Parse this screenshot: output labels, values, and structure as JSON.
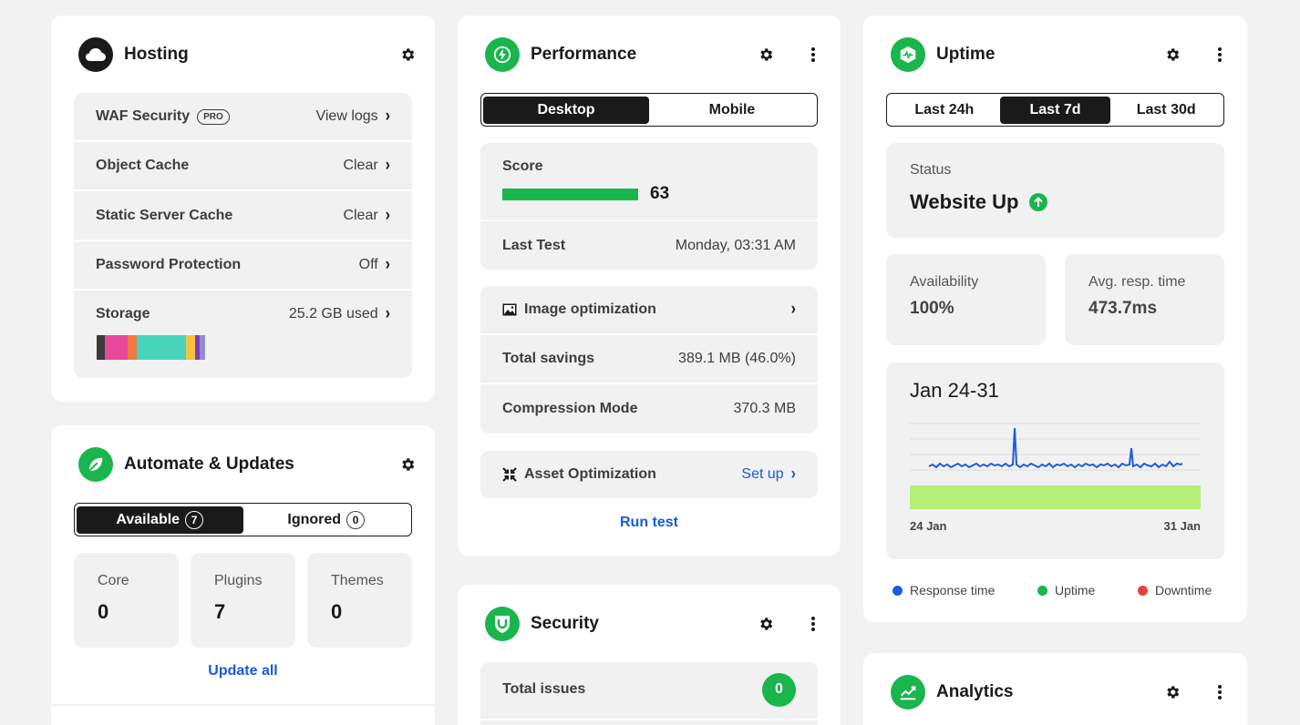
{
  "hosting": {
    "title": "Hosting",
    "rows": [
      {
        "label": "WAF Security",
        "badge": "PRO",
        "value": "View logs"
      },
      {
        "label": "Object Cache",
        "value": "Clear"
      },
      {
        "label": "Static Server Cache",
        "value": "Clear"
      },
      {
        "label": "Password Protection",
        "value": "Off"
      },
      {
        "label": "Storage",
        "value": "25.2 GB used"
      }
    ],
    "storage_colors": [
      "#3b3b3b",
      "#e8489a",
      "#f07a3f",
      "#47d3bc",
      "#f5c242",
      "#7c3fb7",
      "#b0b0b0"
    ]
  },
  "automate": {
    "title": "Automate & Updates",
    "tabs": [
      {
        "label": "Available",
        "count": "7"
      },
      {
        "label": "Ignored",
        "count": "0"
      }
    ],
    "stats": [
      {
        "label": "Core",
        "value": "0"
      },
      {
        "label": "Plugins",
        "value": "7"
      },
      {
        "label": "Themes",
        "value": "0"
      }
    ],
    "update_all": "Update all"
  },
  "performance": {
    "title": "Performance",
    "tabs": [
      "Desktop",
      "Mobile"
    ],
    "score_label": "Score",
    "score": "63",
    "score_fraction": 0.63,
    "last_test_label": "Last Test",
    "last_test_value": "Monday, 03:31 AM",
    "image_opt_label": "Image optimization",
    "total_savings_label": "Total savings",
    "total_savings_value": "389.1 MB (46.0%)",
    "compression_label": "Compression Mode",
    "compression_value": "370.3 MB",
    "asset_label": "Asset Optimization",
    "asset_action": "Set up",
    "run_test": "Run test"
  },
  "security": {
    "title": "Security",
    "total_issues_label": "Total issues",
    "total_issues_value": "0"
  },
  "uptime": {
    "title": "Uptime",
    "tabs": [
      "Last 24h",
      "Last 7d",
      "Last 30d"
    ],
    "status_label": "Status",
    "status_value": "Website Up",
    "availability_label": "Availability",
    "availability_value": "100%",
    "resp_label": "Avg. resp. time",
    "resp_value": "473.7ms",
    "chart_title": "Jan 24-31",
    "x_start": "24 Jan",
    "x_end": "31 Jan",
    "legend": [
      {
        "label": "Response time",
        "color": "#1a5be6"
      },
      {
        "label": "Uptime",
        "color": "#1ab54d"
      },
      {
        "label": "Downtime",
        "color": "#e84040"
      }
    ]
  },
  "analytics": {
    "title": "Analytics"
  }
}
